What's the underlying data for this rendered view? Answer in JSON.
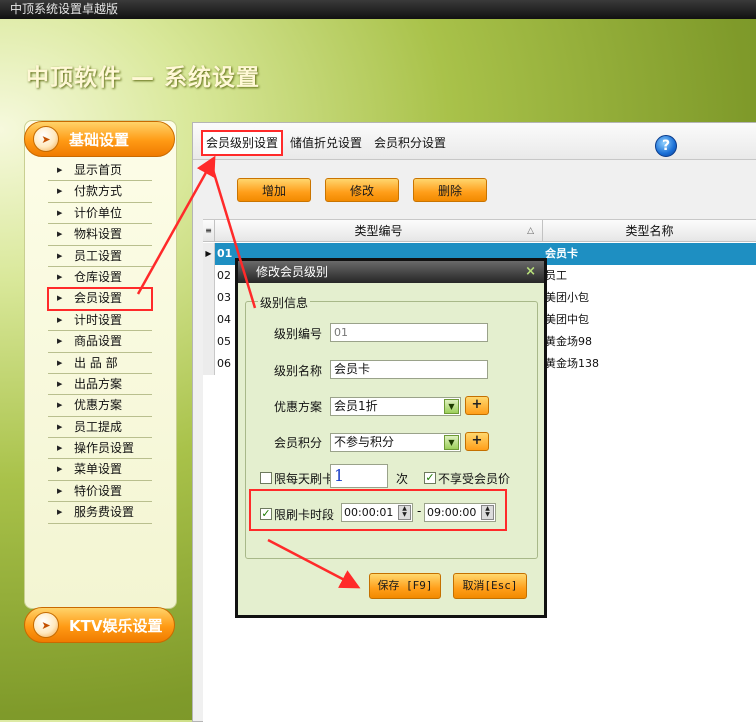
{
  "window_title": "中顶系统设置卓越版",
  "app_title": "中顶软件 — 系统设置",
  "sidebar": {
    "section1": "基础设置",
    "section2": "KTV娱乐设置",
    "items": [
      "显示首页",
      "付款方式",
      "计价单位",
      "物料设置",
      "员工设置",
      "仓库设置",
      "会员设置",
      "计时设置",
      "商品设置",
      "出 品 部",
      "出品方案",
      "优惠方案",
      "员工提成",
      "操作员设置",
      "菜单设置",
      "特价设置",
      "服务费设置"
    ],
    "selected": "会员设置"
  },
  "tabs": [
    "会员级别设置",
    "储值折兑设置",
    "会员积分设置"
  ],
  "toolbar": {
    "add": "增加",
    "edit": "修改",
    "delete": "删除"
  },
  "grid": {
    "columns": [
      "类型编号",
      "类型名称"
    ],
    "rows": [
      {
        "code": "01",
        "name": "会员卡"
      },
      {
        "code": "02",
        "name": "员工"
      },
      {
        "code": "03",
        "name": "美团小包"
      },
      {
        "code": "04",
        "name": "美团中包"
      },
      {
        "code": "05",
        "name": "黄金场98"
      },
      {
        "code": "06",
        "name": "黄金场138"
      }
    ]
  },
  "dialog": {
    "title": "修改会员级别",
    "close": "×",
    "group_label": "级别信息",
    "level_code_label": "级别编号",
    "level_code": "01",
    "level_name_label": "级别名称",
    "level_name": "会员卡",
    "discount_label": "优惠方案",
    "discount_value": "会员1折",
    "points_label": "会员积分",
    "points_value": "不参与积分",
    "daily_limit_label": "限每天刷卡",
    "daily_limit_value": "1",
    "daily_limit_unit": "次",
    "no_member_price_label": "不享受会员价",
    "time_limit_label": "限刷卡时段",
    "time_from": "00:00:01",
    "time_sep": "-",
    "time_to": "09:00:00",
    "save": "保存 [F9]",
    "cancel": "取消[Esc]"
  },
  "colors": {
    "accent_orange": "#ff9e1a",
    "highlight_red": "#ff2a2a",
    "row_selected": "#1e8fc2"
  }
}
